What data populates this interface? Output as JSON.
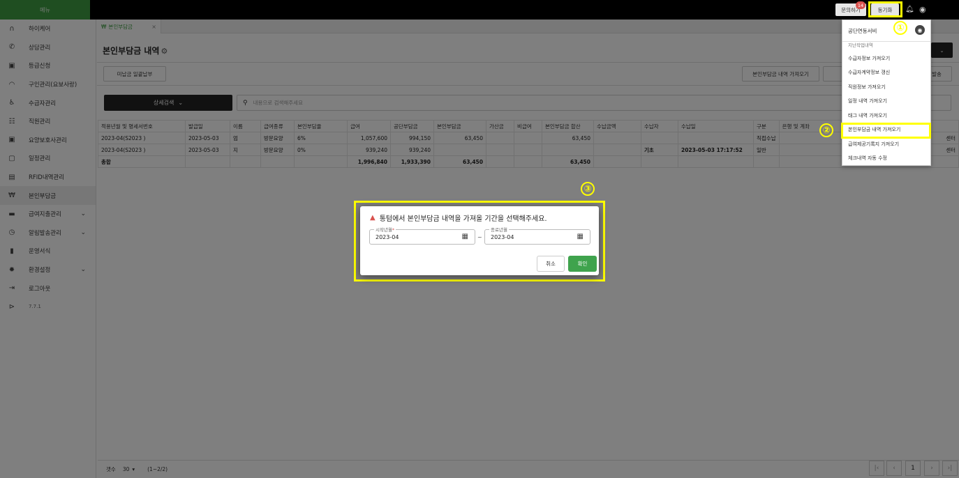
{
  "sidebar": {
    "header": "메뉴",
    "items": [
      {
        "label": "하이케어",
        "icon": "brand-icon"
      },
      {
        "label": "상담관리",
        "icon": "phone-icon"
      },
      {
        "label": "등급신청",
        "icon": "badge-icon"
      },
      {
        "label": "구인관리(요보사랑)",
        "icon": "handshake-icon"
      },
      {
        "label": "수급자관리",
        "icon": "wheelchair-icon"
      },
      {
        "label": "직원관리",
        "icon": "people-icon"
      },
      {
        "label": "요양보호사관리",
        "icon": "id-card-icon"
      },
      {
        "label": "일정관리",
        "icon": "calendar-icon"
      },
      {
        "label": "RFID내역관리",
        "icon": "rfid-icon"
      },
      {
        "label": "본인부담금",
        "icon": "won-icon"
      },
      {
        "label": "급여지출관리",
        "icon": "money-icon"
      },
      {
        "label": "알림발송관리",
        "icon": "alarm-icon"
      },
      {
        "label": "운영서식",
        "icon": "document-icon"
      },
      {
        "label": "환경설정",
        "icon": "settings-icon"
      },
      {
        "label": "로그아웃",
        "icon": "logout-icon"
      },
      {
        "label": "7.7.1",
        "icon": "version-icon"
      }
    ]
  },
  "tabs": [
    {
      "label": "본인부담금"
    }
  ],
  "page": {
    "title": "본인부담금 내역"
  },
  "toolbar": {
    "unpaid_label": "미납금 일괄납부",
    "fetch_label": "본인부담금 내역 가져오기",
    "send_label": "발송"
  },
  "search": {
    "detail_label": "상세검색",
    "placeholder": "내용으로 검색해주세요"
  },
  "table": {
    "headers": [
      "적용년월 및 명세서번호",
      "발급일",
      "이름",
      "급여종류",
      "본인부담율",
      "급여",
      "공단부담금",
      "본인부담금",
      "가산금",
      "비급여",
      "본인부담금 합산",
      "수납금액",
      "수납자",
      "수납일",
      "구분",
      "은행 및 계좌"
    ],
    "rows": [
      [
        "2023-04(S2023            )",
        "2023-05-03",
        "엄",
        "방문요양",
        "6%",
        "1,057,600",
        "994,150",
        "63,450",
        "",
        "",
        "63,450",
        "",
        "",
        "",
        "직접수납",
        ""
      ],
      [
        "2023-04(S2023            )",
        "2023-05-03",
        "지",
        "방문요양",
        "0%",
        "939,240",
        "939,240",
        "",
        "",
        "",
        "",
        "",
        "기초",
        "2023-05-03 17:17:52",
        "일반",
        ""
      ]
    ],
    "total": [
      "총합",
      "",
      "",
      "",
      "",
      "1,996,840",
      "1,933,390",
      "63,450",
      "",
      "",
      "63,450",
      "",
      "",
      "",
      "",
      ""
    ],
    "row_tail": "센터"
  },
  "footer": {
    "count_label": "갯수",
    "page_size": "30",
    "range": "(1~2/2)",
    "current_page": "1"
  },
  "topbar": {
    "inquiry_label": "문의하기",
    "inquiry_badge": "14",
    "sync_label": "동기화"
  },
  "dropdown": {
    "items": [
      "공단연동서비",
      "지난작업내역",
      "수급자정보 가져오기",
      "수급자계약정보 갱신",
      "직원정보 가져오기",
      "일정 내역 가져오기",
      "태그 내역 가져오기",
      "본인부담금 내역 가져오기",
      "급여제공기록지 가져오기",
      "체크내역 자동 수정"
    ]
  },
  "annotations": {
    "one": "①",
    "two": "②",
    "three": "③"
  },
  "dialog": {
    "title": "통텀에서 본인부담금 내역을 가져올 기간을 선택해주세요.",
    "start_label": "시작년월",
    "start_required": "*",
    "start_value": "2023-04",
    "separator": "~",
    "end_label": "종료년월",
    "end_value": "2023-04",
    "cancel_label": "취소",
    "confirm_label": "확인"
  },
  "colors": {
    "brand": "#3f9d43",
    "annotation": "#ffff00",
    "danger": "#d9534f"
  }
}
